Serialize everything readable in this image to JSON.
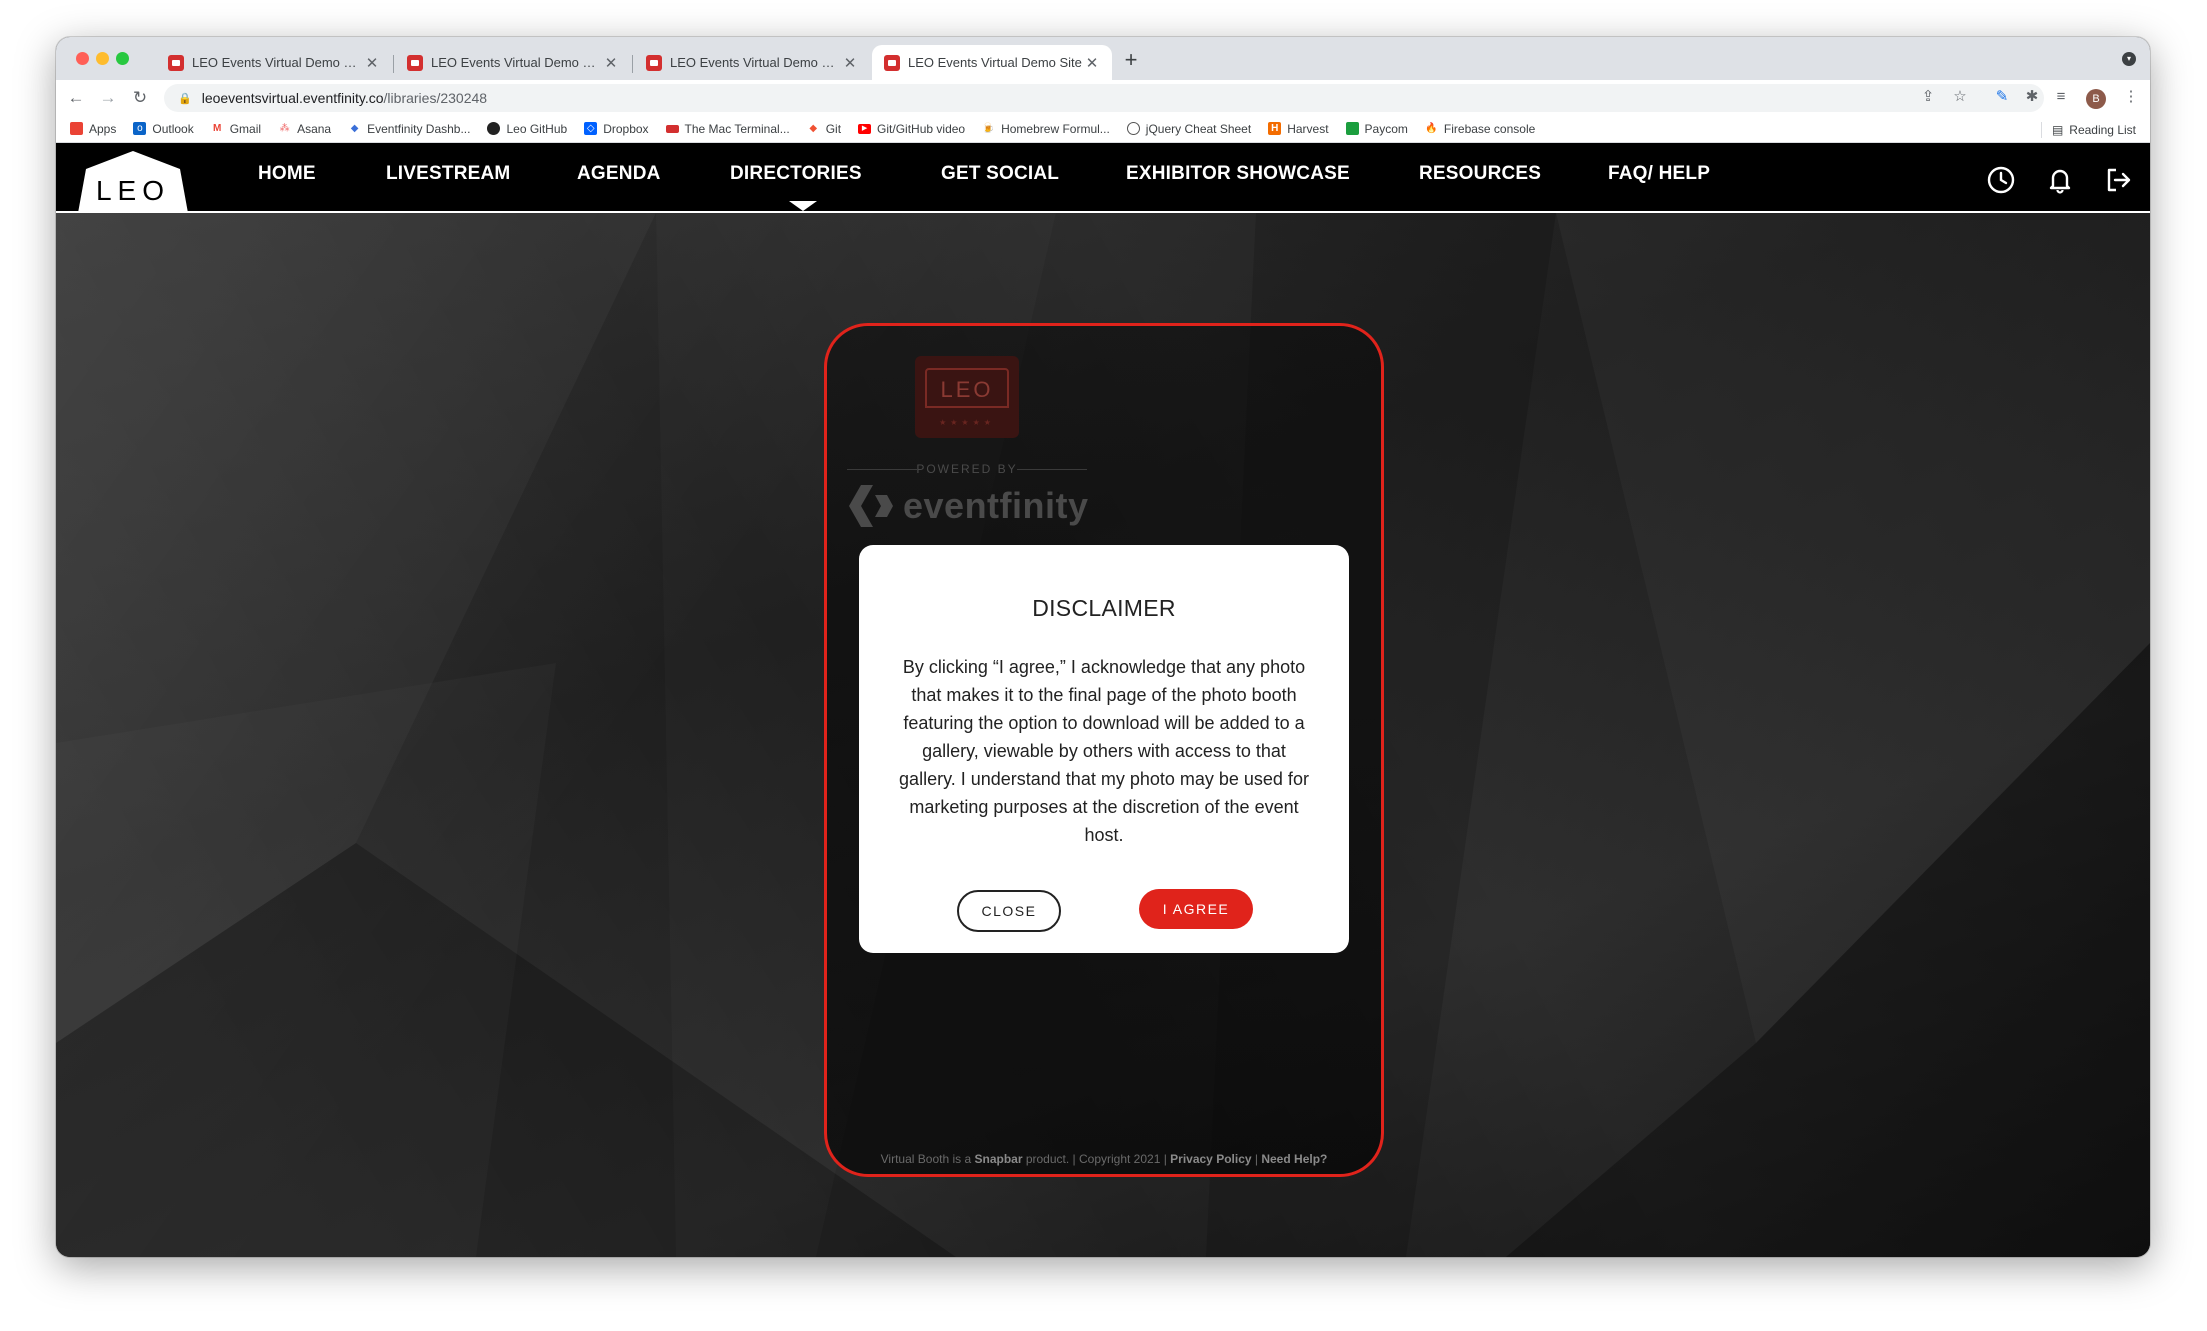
{
  "browser": {
    "tabs": [
      {
        "title": "LEO Events Virtual Demo Site"
      },
      {
        "title": "LEO Events Virtual Demo Site"
      },
      {
        "title": "LEO Events Virtual Demo Site"
      },
      {
        "title": "LEO Events Virtual Demo Site"
      }
    ],
    "active_tab": 3,
    "url_host": "leoeventsvirtual.eventfinity.co",
    "url_path": "/libraries/230248",
    "profile_initial": "B",
    "bookmarks": [
      {
        "label": "Apps",
        "icon": "apps-grid-icon",
        "color": "#ea4335"
      },
      {
        "label": "Outlook",
        "icon": "outlook-icon",
        "color": "#0a64c8"
      },
      {
        "label": "Gmail",
        "icon": "gmail-icon",
        "color": "#ea4335"
      },
      {
        "label": "Asana",
        "icon": "asana-icon",
        "color": "#f06a6a"
      },
      {
        "label": "Eventfinity Dashb...",
        "icon": "eventfinity-icon",
        "color": "#3b6fd8"
      },
      {
        "label": "Leo GitHub",
        "icon": "github-icon",
        "color": "#222222"
      },
      {
        "label": "Dropbox",
        "icon": "dropbox-icon",
        "color": "#0061ff"
      },
      {
        "label": "The Mac Terminal...",
        "icon": "terminal-icon",
        "color": "#d32f2f"
      },
      {
        "label": "Git",
        "icon": "git-icon",
        "color": "#f05133"
      },
      {
        "label": "Git/GitHub video",
        "icon": "youtube-icon",
        "color": "#ff0000"
      },
      {
        "label": "Homebrew Formul...",
        "icon": "homebrew-icon",
        "color": "#c8a06a"
      },
      {
        "label": "jQuery Cheat Sheet",
        "icon": "jquery-icon",
        "color": "#555555"
      },
      {
        "label": "Harvest",
        "icon": "harvest-icon",
        "color": "#f36c00"
      },
      {
        "label": "Paycom",
        "icon": "paycom-icon",
        "color": "#1b9e3e"
      },
      {
        "label": "Firebase console",
        "icon": "firebase-icon",
        "color": "#ffa000"
      }
    ],
    "reading_list": "Reading List"
  },
  "site": {
    "logo_text": "LEO",
    "nav": [
      {
        "label": "HOME"
      },
      {
        "label": "LIVESTREAM"
      },
      {
        "label": "AGENDA"
      },
      {
        "label": "DIRECTORIES"
      },
      {
        "label": "GET SOCIAL"
      },
      {
        "label": "EXHIBITOR SHOWCASE"
      },
      {
        "label": "RESOURCES"
      },
      {
        "label": "FAQ/ HELP"
      }
    ],
    "accent": "#e0231b"
  },
  "booth": {
    "logo_text": "LEO",
    "logo_stars": "★★★★★",
    "powered_by": "POWERED BY",
    "brand": "eventfinity",
    "footer_pre": "Virtual Booth is a ",
    "footer_brand": "Snapbar",
    "footer_mid": " product. | Copyright 2021 | ",
    "footer_privacy": "Privacy Policy",
    "footer_sep": " | ",
    "footer_help": "Need Help?"
  },
  "modal": {
    "title": "DISCLAIMER",
    "body": "By clicking “I agree,” I acknowledge that any photo that makes it to the final page of the photo booth featuring the option to download will be added to a gallery, viewable by others with access to that gallery. I understand that my photo may be used for marketing purposes at the discretion of the event host.",
    "close_label": "CLOSE",
    "agree_label": "I AGREE"
  }
}
